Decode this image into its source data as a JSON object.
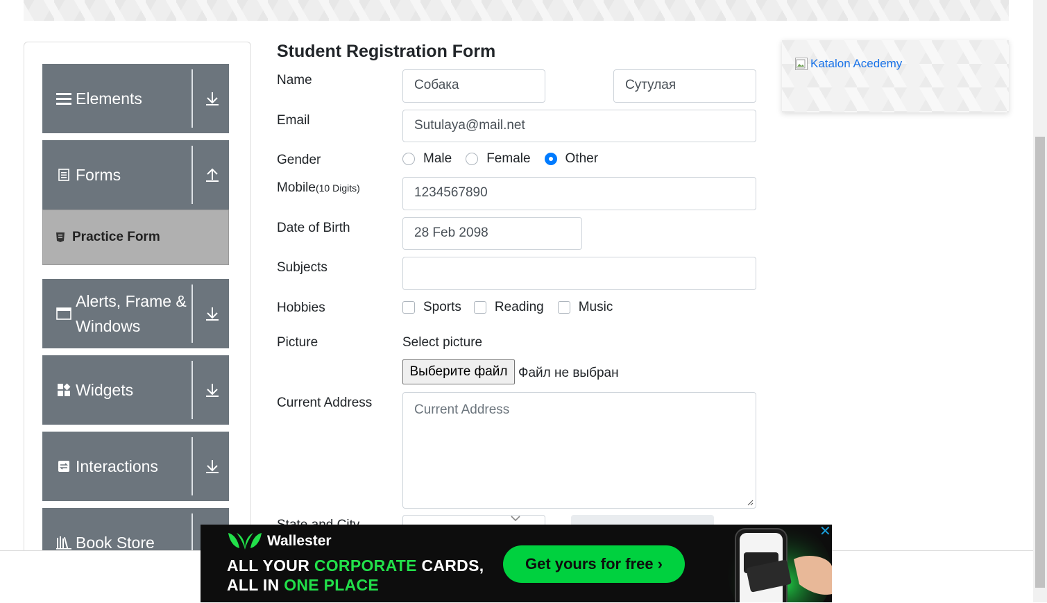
{
  "sidebar": {
    "groups": [
      {
        "label": "Elements",
        "icon": "hamburger-icon",
        "arrow": "down"
      },
      {
        "label": "Forms",
        "icon": "document-icon",
        "arrow": "up"
      },
      {
        "label": "Alerts, Frame & Windows",
        "icon": "window-icon",
        "arrow": "down"
      },
      {
        "label": "Widgets",
        "icon": "widgets-icon",
        "arrow": "down"
      },
      {
        "label": "Interactions",
        "icon": "interactions-icon",
        "arrow": "down"
      },
      {
        "label": "Book Store",
        "icon": "books-icon",
        "arrow": "down"
      }
    ],
    "active_item": "Practice Form"
  },
  "form": {
    "title": "Student Registration Form",
    "name": {
      "label": "Name",
      "first": "Собака",
      "last": "Сутулая"
    },
    "email": {
      "label": "Email",
      "value": "Sutulaya@mail.net"
    },
    "gender": {
      "label": "Gender",
      "options": [
        "Male",
        "Female",
        "Other"
      ],
      "selected": "Other"
    },
    "mobile": {
      "label": "Mobile",
      "hint": "(10 Digits)",
      "value": "1234567890"
    },
    "dob": {
      "label": "Date of Birth",
      "value": "28 Feb 2098"
    },
    "subjects": {
      "label": "Subjects",
      "value": ""
    },
    "hobbies": {
      "label": "Hobbies",
      "options": [
        "Sports",
        "Reading",
        "Music"
      ]
    },
    "picture": {
      "label": "Picture",
      "select_text": "Select picture",
      "button": "Выберите файл",
      "status": "Файл не выбран"
    },
    "address": {
      "label": "Current Address",
      "placeholder": "Current Address"
    },
    "state_city": {
      "label": "State and City"
    }
  },
  "side_ad": {
    "alt_text": "Katalon Acedemy"
  },
  "bottom_ad": {
    "brand": "Wallester",
    "line1_pre": "ALL YOUR ",
    "line1_hl": "CORPORATE",
    "line1_post": " CARDS,",
    "line2_pre": "ALL IN ",
    "line2_hl": "ONE PLACE",
    "cta": "Get yours for free ›",
    "close": "✕"
  },
  "colors": {
    "sidebar_group": "#6c757d",
    "radio_selected": "#007bff",
    "ad_green": "#00d13f",
    "ad_bg": "#0d0d0d"
  }
}
